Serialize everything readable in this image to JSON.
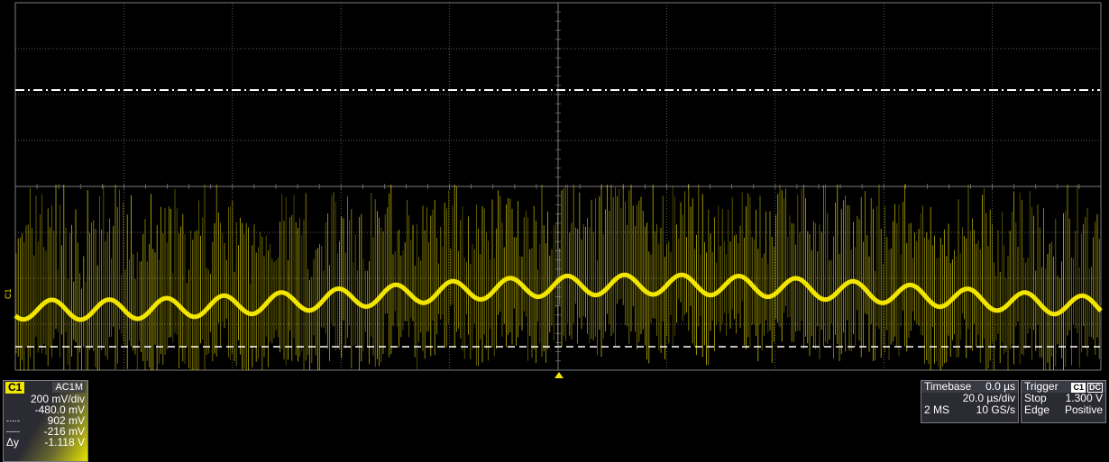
{
  "colors": {
    "trace": "#f2e600",
    "grid": "#7d7d7d",
    "bg": "#000000",
    "panel": "#2b2b33"
  },
  "channel": {
    "tag": "C1",
    "coupling": "AC1M",
    "marker": "C1",
    "vdiv": "200 mV/div",
    "offset": "-480.0 mV",
    "cursor1": "902 mV",
    "cursor2": "-216 mV",
    "dy_label": "Δy",
    "dy_value": "-1.118 V"
  },
  "timebase": {
    "label": "Timebase",
    "delay": "0.0 µs",
    "tdiv": "20.0 µs/div",
    "samples": "2 MS",
    "rate": "10 GS/s"
  },
  "trigger": {
    "label": "Trigger",
    "source": "C1",
    "coupling": "DC",
    "mode": "Stop",
    "level": "1.300 V",
    "type": "Edge",
    "slope": "Positive"
  }
}
